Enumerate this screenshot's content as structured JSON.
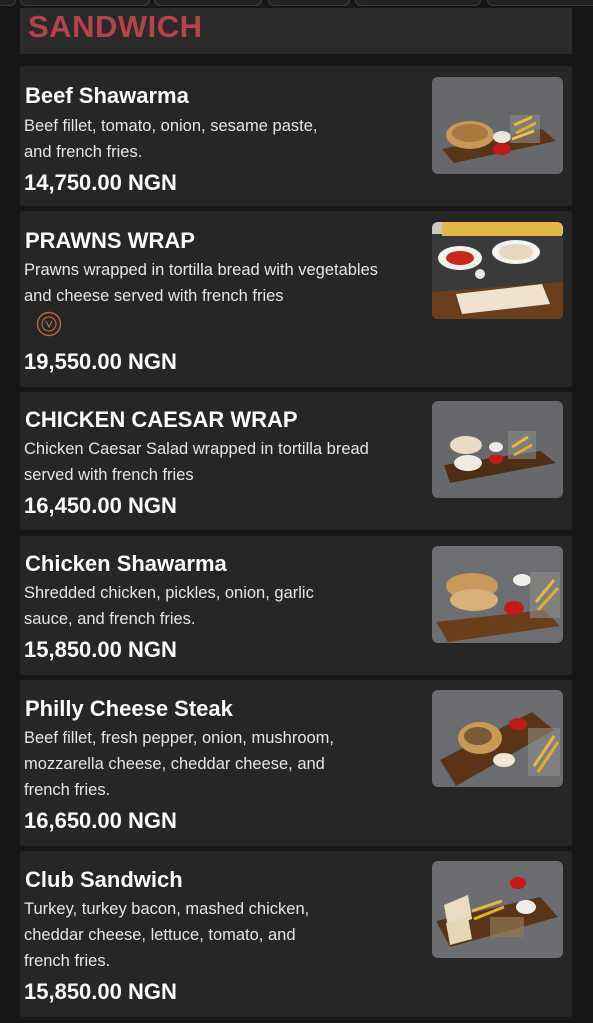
{
  "section": {
    "title": "SANDWICH"
  },
  "items": [
    {
      "name": "Beef Shawarma",
      "desc_lines": [
        "Beef fillet, tomato, onion, sesame paste,",
        "and french fries."
      ],
      "price": "14,750.00 NGN",
      "image_icon": "beef-shawarma-photo"
    },
    {
      "name": "PRAWNS WRAP",
      "desc_lines": [
        "Prawns wrapped in tortilla bread with vegetables",
        "and cheese served with french fries"
      ],
      "price": "19,550.00 NGN",
      "image_icon": "prawns-wrap-photo",
      "badge_icon": "dietary-badge-icon"
    },
    {
      "name": "CHICKEN CAESAR WRAP",
      "desc_lines": [
        "Chicken Caesar Salad wrapped in tortilla bread",
        "served with french fries"
      ],
      "price": "16,450.00 NGN",
      "image_icon": "chicken-caesar-wrap-photo"
    },
    {
      "name": "Chicken Shawarma",
      "desc_lines": [
        "Shredded chicken, pickles, onion, garlic",
        "sauce, and french fries."
      ],
      "price": "15,850.00 NGN",
      "image_icon": "chicken-shawarma-photo"
    },
    {
      "name": "Philly Cheese Steak",
      "desc_lines": [
        "Beef fillet, fresh pepper, onion, mushroom,",
        "mozzarella cheese, cheddar cheese, and",
        "french fries."
      ],
      "price": "16,650.00 NGN",
      "image_icon": "philly-cheese-steak-photo"
    },
    {
      "name": "Club Sandwich",
      "desc_lines": [
        "Turkey, turkey bacon, mashed chicken,",
        "cheddar cheese, lettuce, tomato, and",
        "french fries."
      ],
      "price": "15,850.00 NGN",
      "image_icon": "club-sandwich-photo"
    }
  ],
  "colors": {
    "background": "#161616",
    "card": "#262626",
    "section_title": "#b7424a",
    "text": "#ffffff"
  }
}
